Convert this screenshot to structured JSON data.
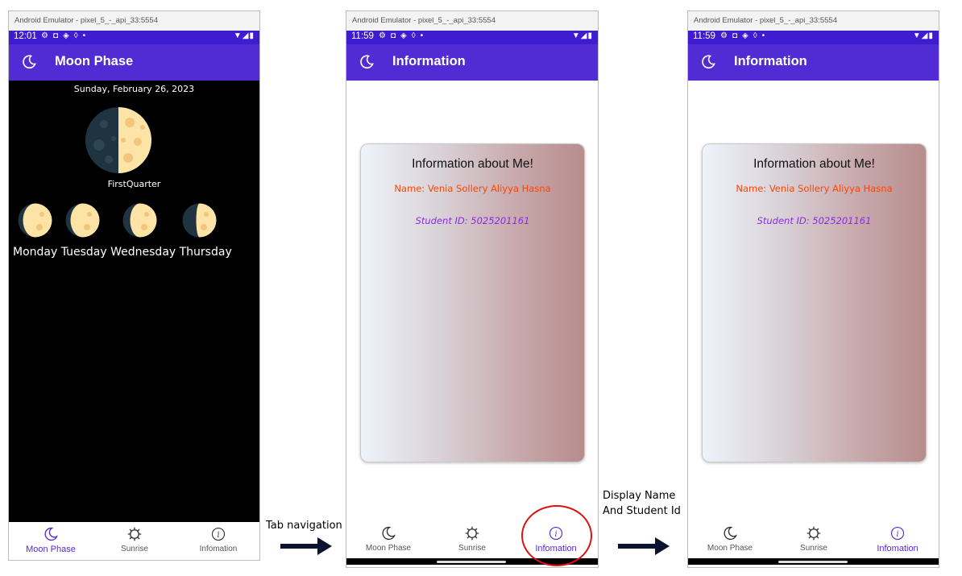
{
  "emulators": [
    {
      "window_title": "Android Emulator - pixel_5_-_api_33:5554",
      "time": "12:01",
      "appbar_title": "Moon Phase",
      "date": "Sunday, February 26, 2023",
      "phase": "FirstQuarter",
      "days": "Monday Tuesday Wednesday Thursday",
      "tabs": [
        "Moon Phase",
        "Sunrise",
        "Infomation"
      ],
      "active_tab": "Moon Phase"
    },
    {
      "window_title": "Android Emulator - pixel_5_-_api_33:5554",
      "time": "11:59",
      "appbar_title": "Information",
      "card": {
        "heading": "Information about Me!",
        "name": "Name: Venia Sollery Aliyya Hasna",
        "student_id": "Student ID: 5025201161"
      },
      "tabs": [
        "Moon Phase",
        "Sunrise",
        "Infomation"
      ],
      "active_tab": "Infomation"
    },
    {
      "window_title": "Android Emulator - pixel_5_-_api_33:5554",
      "time": "11:59",
      "appbar_title": "Information",
      "card": {
        "heading": "Information about Me!",
        "name": "Name: Venia Sollery Aliyya Hasna",
        "student_id": "Student ID: 5025201161"
      },
      "tabs": [
        "Moon Phase",
        "Sunrise",
        "Infomation"
      ],
      "active_tab": "Infomation"
    }
  ],
  "annotations": {
    "tab_navigation": "Tab navigation",
    "display_line1": "Display Name",
    "display_line2": "And Student Id"
  },
  "colors": {
    "status_bar": "#3f1ccf",
    "app_bar": "#512bd4",
    "name_text": "#ff4500",
    "student_id_text": "#8a2be2",
    "highlight_circle": "#dd1111"
  },
  "icons": [
    "moon-icon",
    "sun-gear-icon",
    "info-icon",
    "wifi-icon",
    "signal-icon",
    "battery-icon",
    "arrow-right-icon"
  ]
}
